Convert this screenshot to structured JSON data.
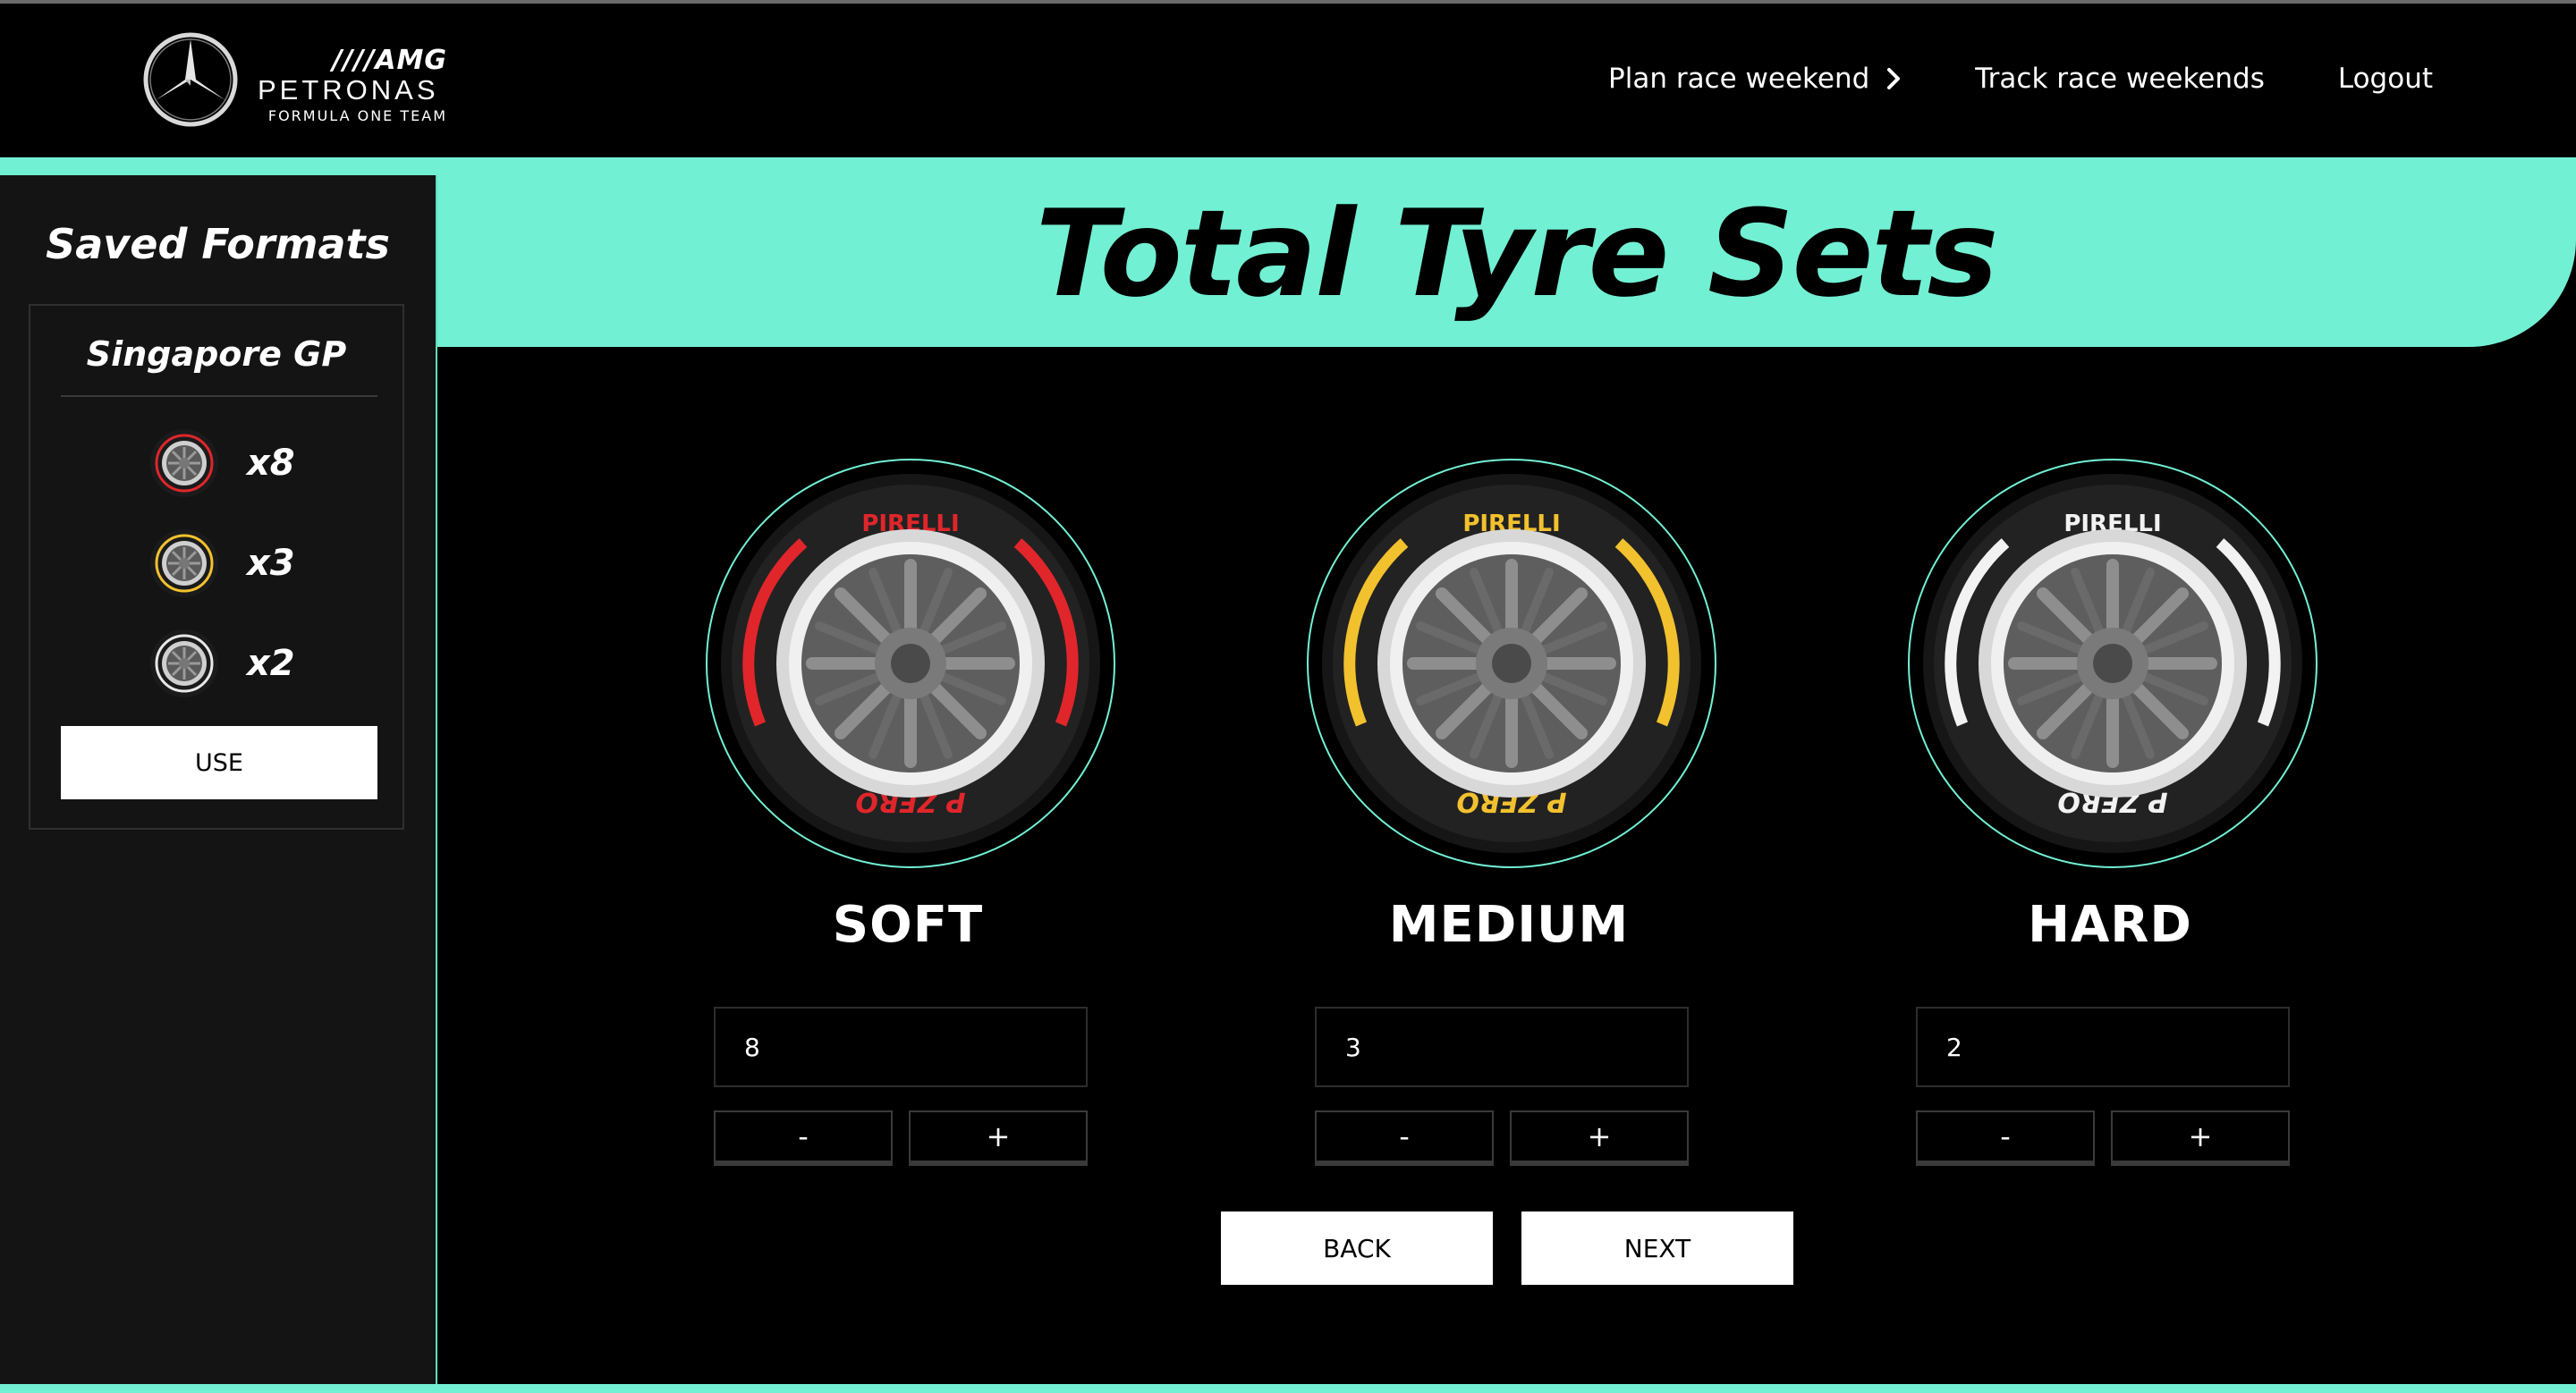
{
  "header": {
    "brand": {
      "amg": "////AMG",
      "petronas": "PETRONAS",
      "team": "FORMULA ONE TEAM"
    },
    "nav": [
      {
        "label": "Plan race weekend",
        "icon": "chevron-right-icon"
      },
      {
        "label": "Track race weekends"
      },
      {
        "label": "Logout"
      }
    ]
  },
  "page": {
    "title": "Total Tyre Sets"
  },
  "sidebar": {
    "title": "Saved Formats",
    "format": {
      "name": "Singapore GP",
      "items": [
        {
          "compound": "soft",
          "count": "x8"
        },
        {
          "compound": "medium",
          "count": "x3"
        },
        {
          "compound": "hard",
          "count": "x2"
        }
      ],
      "use_label": "USE"
    }
  },
  "tyres": [
    {
      "label": "SOFT",
      "value": "8",
      "color": "#e0262b",
      "minus": "-",
      "plus": "+"
    },
    {
      "label": "MEDIUM",
      "value": "3",
      "color": "#f2c12e",
      "minus": "-",
      "plus": "+"
    },
    {
      "label": "HARD",
      "value": "2",
      "color": "#f2f2f2",
      "minus": "-",
      "plus": "+"
    }
  ],
  "actions": {
    "back": "BACK",
    "next": "NEXT"
  },
  "colors": {
    "accent": "#72f0d4",
    "background": "#000000",
    "sidebar": "#141414"
  },
  "tyre_brand": {
    "maker": "PIRELLI",
    "model": "P ZERO"
  }
}
